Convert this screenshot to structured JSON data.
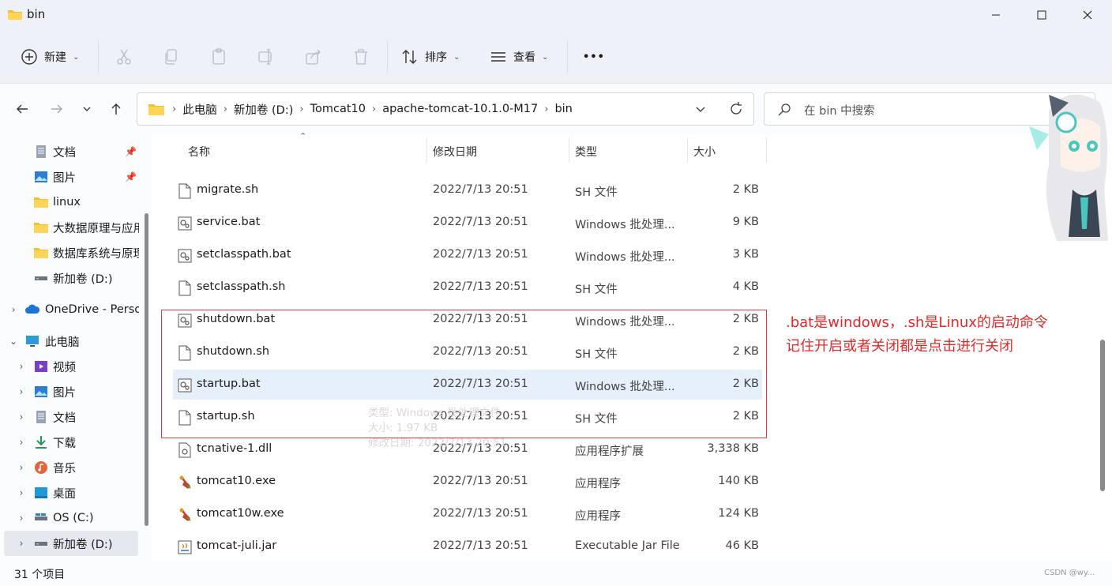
{
  "window": {
    "title": "bin"
  },
  "toolbar": {
    "new_label": "新建",
    "sort_label": "排序",
    "view_label": "查看",
    "more_label": "•••"
  },
  "address": {
    "crumbs": [
      "此电脑",
      "新加卷 (D:)",
      "Tomcat10",
      "apache-tomcat-10.1.0-M17",
      "bin"
    ]
  },
  "search": {
    "placeholder": "在 bin 中搜索"
  },
  "sidebar": {
    "items": [
      {
        "label": "文档",
        "icon": "document-icon",
        "pinned": true
      },
      {
        "label": "图片",
        "icon": "pictures-icon",
        "pinned": true
      },
      {
        "label": "linux",
        "icon": "folder-icon"
      },
      {
        "label": "大数据原理与应用",
        "icon": "folder-icon"
      },
      {
        "label": "数据库系统与原理",
        "icon": "folder-icon"
      },
      {
        "label": "新加卷 (D:)",
        "icon": "drive-icon"
      },
      {
        "label": "OneDrive - Personal",
        "icon": "cloud-icon"
      },
      {
        "label": "此电脑",
        "icon": "computer-icon"
      },
      {
        "label": "视频",
        "icon": "video-icon"
      },
      {
        "label": "图片",
        "icon": "pictures-icon"
      },
      {
        "label": "文档",
        "icon": "document-icon"
      },
      {
        "label": "下载",
        "icon": "download-icon"
      },
      {
        "label": "音乐",
        "icon": "music-icon"
      },
      {
        "label": "桌面",
        "icon": "desktop-icon"
      },
      {
        "label": "OS (C:)",
        "icon": "drive-icon"
      },
      {
        "label": "新加卷 (D:)",
        "icon": "drive-icon"
      }
    ]
  },
  "columns": {
    "name": "名称",
    "date": "修改日期",
    "type": "类型",
    "size": "大小"
  },
  "files": [
    {
      "name": "migrate.sh",
      "date": "2022/7/13 20:51",
      "type": "SH 文件",
      "size": "2 KB",
      "icon": "file-icon"
    },
    {
      "name": "service.bat",
      "date": "2022/7/13 20:51",
      "type": "Windows 批处理...",
      "size": "9 KB",
      "icon": "bat-file-icon"
    },
    {
      "name": "setclasspath.bat",
      "date": "2022/7/13 20:51",
      "type": "Windows 批处理...",
      "size": "3 KB",
      "icon": "bat-file-icon"
    },
    {
      "name": "setclasspath.sh",
      "date": "2022/7/13 20:51",
      "type": "SH 文件",
      "size": "4 KB",
      "icon": "file-icon"
    },
    {
      "name": "shutdown.bat",
      "date": "2022/7/13 20:51",
      "type": "Windows 批处理...",
      "size": "2 KB",
      "icon": "bat-file-icon"
    },
    {
      "name": "shutdown.sh",
      "date": "2022/7/13 20:51",
      "type": "SH 文件",
      "size": "2 KB",
      "icon": "file-icon"
    },
    {
      "name": "startup.bat",
      "date": "2022/7/13 20:51",
      "type": "Windows 批处理...",
      "size": "2 KB",
      "icon": "bat-file-icon",
      "hover": true
    },
    {
      "name": "startup.sh",
      "date": "2022/7/13 20:51",
      "type": "SH 文件",
      "size": "2 KB",
      "icon": "file-icon"
    },
    {
      "name": "tcnative-1.dll",
      "date": "2022/7/13 20:51",
      "type": "应用程序扩展",
      "size": "3,338 KB",
      "icon": "dll-file-icon"
    },
    {
      "name": "tomcat10.exe",
      "date": "2022/7/13 20:51",
      "type": "应用程序",
      "size": "140 KB",
      "icon": "tomcat-exe-icon"
    },
    {
      "name": "tomcat10w.exe",
      "date": "2022/7/13 20:51",
      "type": "应用程序",
      "size": "124 KB",
      "icon": "tomcat-exe-icon"
    },
    {
      "name": "tomcat-juli.jar",
      "date": "2022/7/13 20:51",
      "type": "Executable Jar File",
      "size": "46 KB",
      "icon": "jar-file-icon"
    }
  ],
  "tooltip": {
    "line1": "类型: Windows 批处理文件",
    "line2": "大小: 1.97 KB",
    "line3": "修改日期: 2022/7/13 20:51"
  },
  "annotation": {
    "line1": ".bat是windows，.sh是Linux的启动命令",
    "line2": "记住开启或者关闭都是点击进行关闭"
  },
  "status": {
    "count": "31 个项目"
  },
  "watermark": "CSDN @wy..."
}
